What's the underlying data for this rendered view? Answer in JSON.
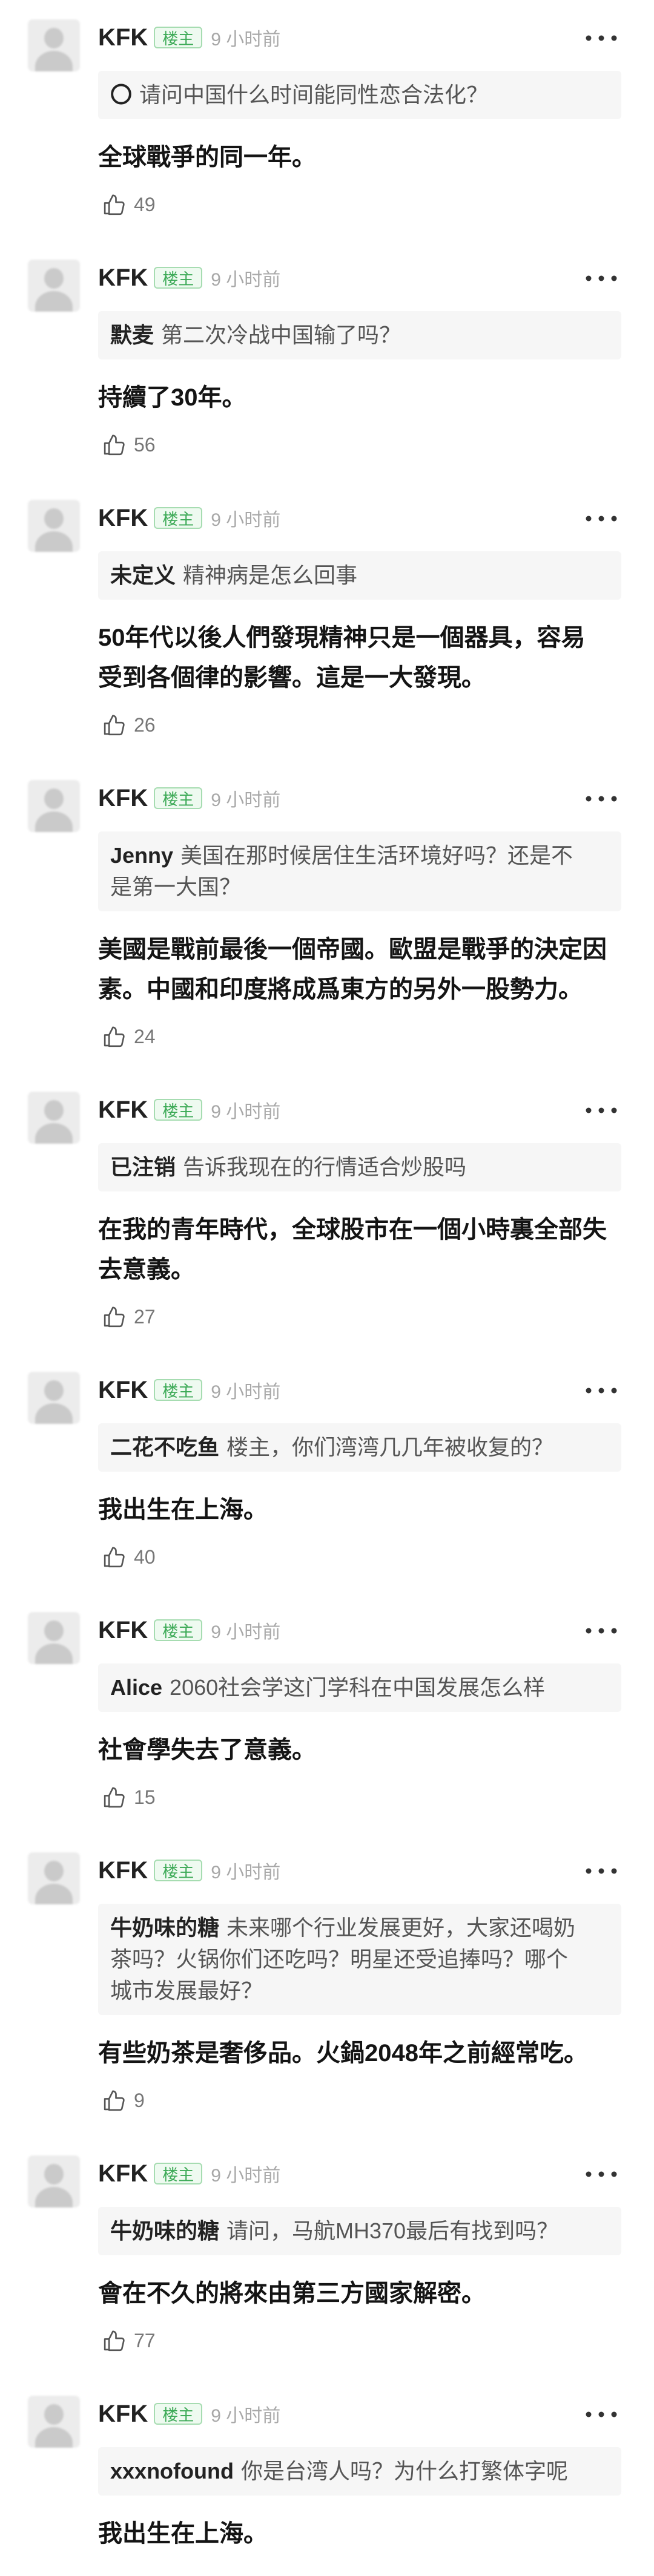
{
  "colors": {
    "badge_green": "#3daa57",
    "badge_bg": "#eefaf0",
    "quote_bg": "#f6f6f6",
    "meta_gray": "#a8a8a8",
    "text_dark": "#141414"
  },
  "icons": {
    "more": "more-options-icon",
    "like": "thumb-up-icon",
    "avatar": "avatar"
  },
  "posts": [
    {
      "author": "KFK",
      "badge": "楼主",
      "time": "9 小时前",
      "quote": {
        "user": "〇",
        "lines": [
          "请问中国什么时间能同性恋合法化？"
        ]
      },
      "answer": [
        "全球戰爭的同一年。"
      ],
      "likes": 49
    },
    {
      "author": "KFK",
      "badge": "楼主",
      "time": "9 小时前",
      "quote": {
        "user": "默麦",
        "lines": [
          "第二次冷战中国输了吗？"
        ]
      },
      "answer": [
        "持續了30年。"
      ],
      "likes": 56
    },
    {
      "author": "KFK",
      "badge": "楼主",
      "time": "9 小时前",
      "quote": {
        "user": "未定义",
        "lines": [
          "精神病是怎么回事"
        ]
      },
      "answer": [
        "50年代以後人們發現精神只是一個器具，容易",
        "受到各個律的影響。這是一大發現。"
      ],
      "likes": 26
    },
    {
      "author": "KFK",
      "badge": "楼主",
      "time": "9 小时前",
      "quote": {
        "user": "Jenny",
        "lines": [
          "美国在那时候居住生活环境好吗？还是不",
          "是第一大国？"
        ]
      },
      "answer": [
        "美國是戰前最後一個帝國。歐盟是戰爭的決定因",
        "素。中國和印度將成爲東方的另外一股勢力。"
      ],
      "likes": 24
    },
    {
      "author": "KFK",
      "badge": "楼主",
      "time": "9 小时前",
      "quote": {
        "user": "已注销",
        "lines": [
          "告诉我现在的行情适合炒股吗"
        ]
      },
      "answer": [
        "在我的青年時代，全球股市在一個小時裏全部失",
        "去意義。"
      ],
      "likes": 27
    },
    {
      "author": "KFK",
      "badge": "楼主",
      "time": "9 小时前",
      "quote": {
        "user": "二花不吃鱼",
        "lines": [
          "楼主，你们湾湾几几年被收复的？"
        ]
      },
      "answer": [
        "我出生在上海。"
      ],
      "likes": 40
    },
    {
      "author": "KFK",
      "badge": "楼主",
      "time": "9 小时前",
      "quote": {
        "user": "Alice",
        "lines": [
          "2060社会学这门学科在中国发展怎么样"
        ]
      },
      "answer": [
        "社會學失去了意義。"
      ],
      "likes": 15
    },
    {
      "author": "KFK",
      "badge": "楼主",
      "time": "9 小时前",
      "quote": {
        "user": "牛奶味的糖",
        "lines": [
          "未来哪个行业发展更好，大家还喝奶",
          "茶吗？火锅你们还吃吗？明星还受追捧吗？哪个",
          "城市发展最好？"
        ]
      },
      "answer": [
        "有些奶茶是奢侈品。火鍋2048年之前經常吃。"
      ],
      "likes": 9
    },
    {
      "author": "KFK",
      "badge": "楼主",
      "time": "9 小时前",
      "quote": {
        "user": "牛奶味的糖",
        "lines": [
          "请问，马航MH370最后有找到吗？"
        ]
      },
      "answer": [
        "會在不久的將來由第三方國家解密。"
      ],
      "likes": 77
    },
    {
      "author": "KFK",
      "badge": "楼主",
      "time": "9 小时前",
      "quote": {
        "user": "xxxnofound",
        "lines": [
          "你是台湾人吗？为什么打繁体字呢"
        ]
      },
      "answer": [
        "我出生在上海。"
      ]
    }
  ]
}
